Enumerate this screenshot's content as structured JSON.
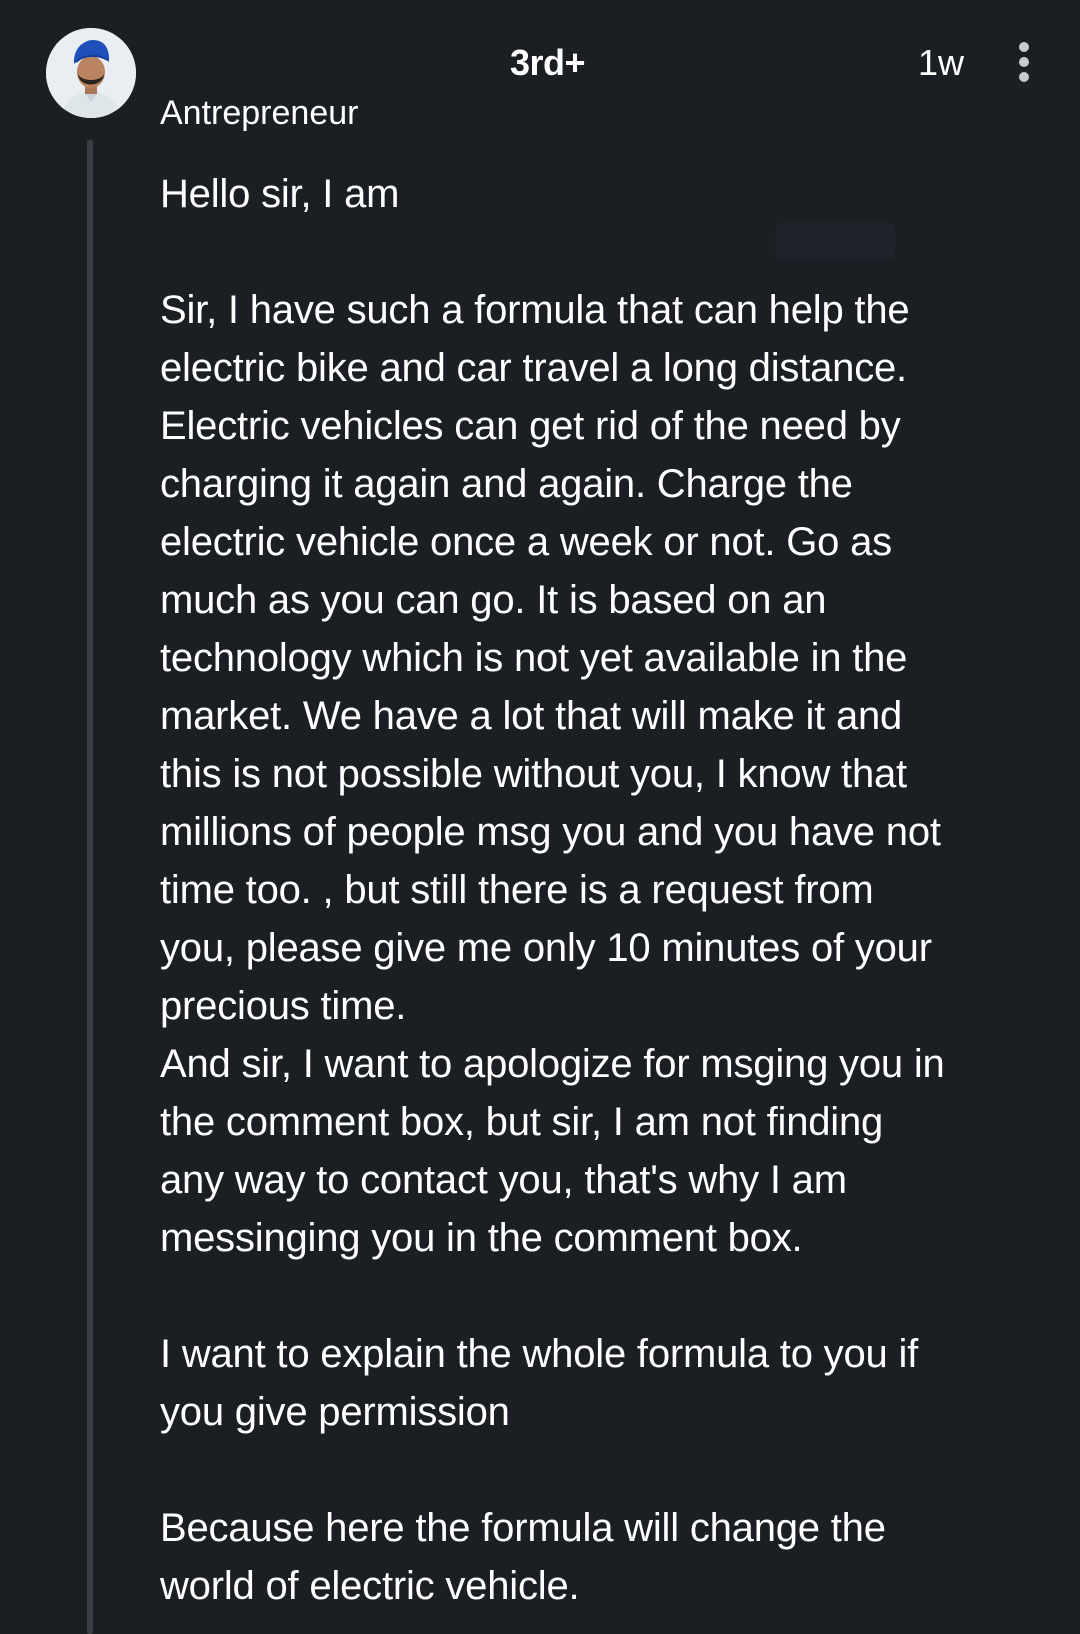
{
  "comment": {
    "avatar_icon": "profile-photo-icon",
    "connection_degree": "3rd+",
    "timestamp": "1w",
    "more_icon": "vertical-dots-icon",
    "headline": "Antrepreneur",
    "body": "Hello sir, I am\n\nSir, I have such a formula that can help the\nelectric bike and car travel a long distance.\nElectric vehicles can get rid of the need by\ncharging it again and again. Charge the\nelectric vehicle once a week or not. Go as\nmuch as you can go. It is based on an\ntechnology which is not yet available in the\nmarket. We have a lot that will make it and\nthis is not possible without you, I know that\nmillions of people msg you and you have not\ntime too. , but still there is a request from\nyou, please give me only 10 minutes of your\nprecious time.\nAnd sir, I want to apologize for msging you in\nthe comment box, but sir, I am not finding\nany way to contact you, that's why I am\nmessinging you in the comment box.\n\nI want to explain the whole formula to you if\nyou give permission\n\nBecause here the formula will change the\nworld of electric vehicle."
  },
  "colors": {
    "background": "#1b1f23",
    "text": "#ffffff",
    "thread_line": "#3a3f45",
    "avatar_turban": "#1f4fb8"
  }
}
